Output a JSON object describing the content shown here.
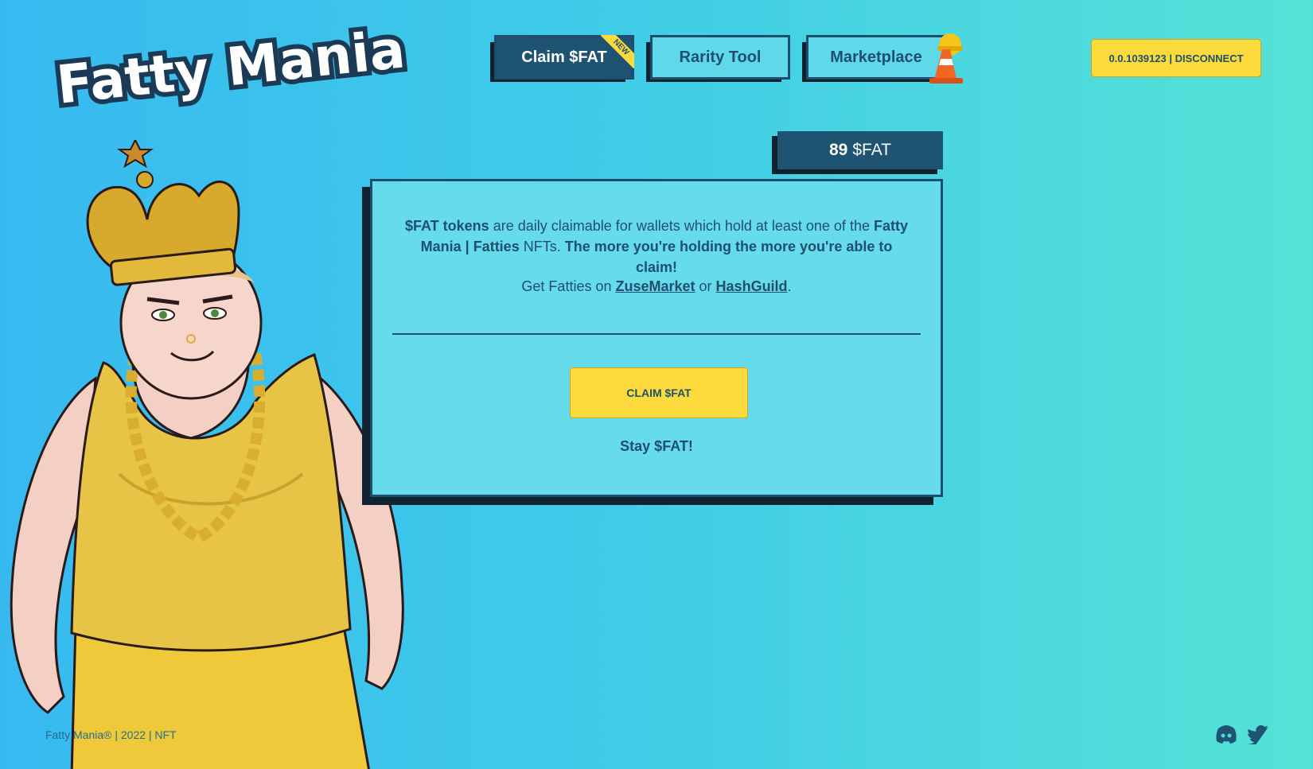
{
  "brand": {
    "logo_text": "Fatty Mania"
  },
  "nav": {
    "items": [
      {
        "label": "Claim $FAT",
        "badge": "NEW",
        "active": true
      },
      {
        "label": "Rarity Tool"
      },
      {
        "label": "Marketplace",
        "icon": "construction-cone-icon"
      }
    ]
  },
  "wallet": {
    "label": "0.0.1039123 | DISCONNECT"
  },
  "balance": {
    "amount": "89",
    "unit": "$FAT"
  },
  "card": {
    "intro_bold_1": "$FAT tokens",
    "intro_text_1": " are daily claimable for wallets which hold at least one of the ",
    "intro_bold_2": "Fatty Mania | Fatties",
    "intro_text_2": " NFTs. ",
    "intro_bold_3": "The more you're holding the more you're able to claim!",
    "get_prefix": "Get Fatties on ",
    "link_1": "ZuseMarket",
    "get_or": " or ",
    "link_2": "HashGuild",
    "get_suffix": ".",
    "claim_button": "CLAIM $FAT",
    "tagline": "Stay $FAT!"
  },
  "footer": {
    "text": "Fatty Mania® | 2022 | NFT",
    "social": [
      "discord-icon",
      "twitter-icon"
    ]
  },
  "colors": {
    "navy": "#1f5372",
    "accent_yellow": "#fddb3c",
    "card_bg": "#66dbec",
    "bg_left": "#37b9f0",
    "bg_right": "#55e2d6"
  }
}
